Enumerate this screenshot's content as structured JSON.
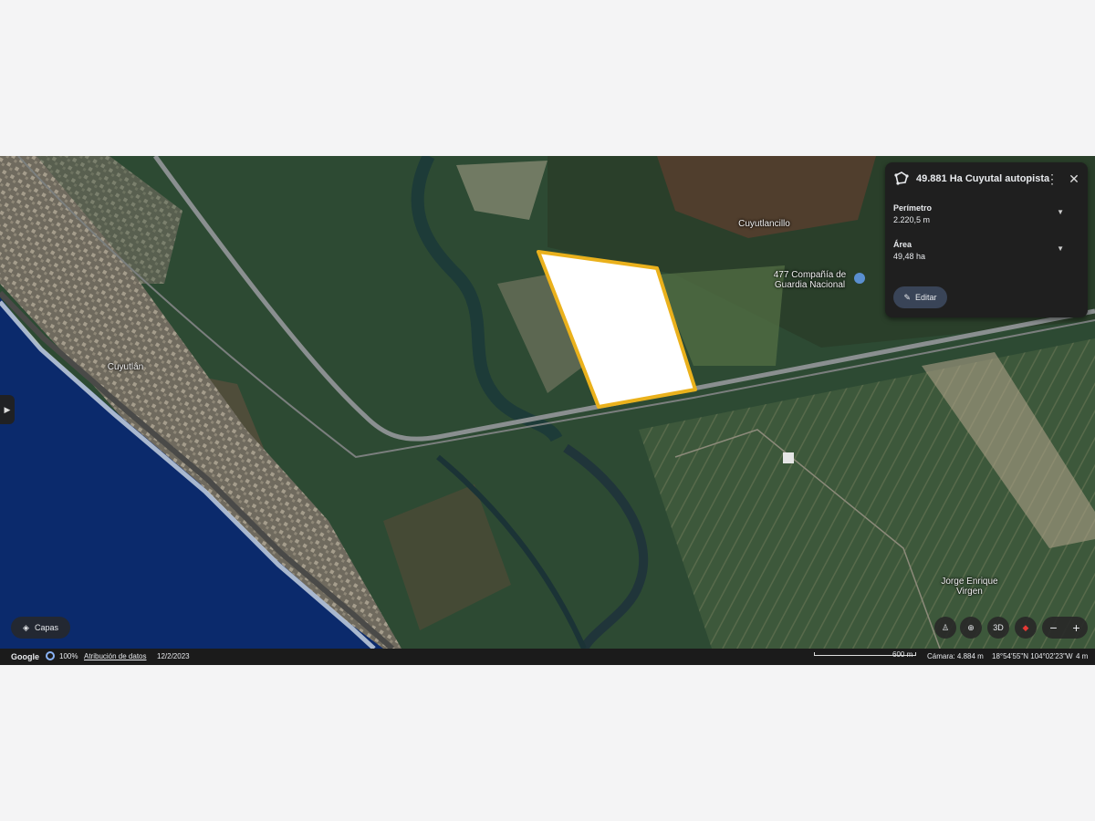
{
  "map": {
    "place_labels": [
      {
        "text": "Cuyutlancillo"
      },
      {
        "text": "477 Compañía de"
      },
      {
        "text": "Guardia Nacional"
      },
      {
        "text": "Cuyutlán"
      },
      {
        "text": "Jorge Enrique"
      },
      {
        "text": "Virgen"
      }
    ],
    "colors": {
      "polygon_fill": "#ffffff",
      "polygon_stroke": "#eab11c",
      "ocean": "#0b2a6c"
    }
  },
  "panel": {
    "title": "49.881 Ha Cuyutal autopista",
    "perimeter_label": "Perímetro",
    "perimeter_value": "2.220,5 m",
    "area_label": "Área",
    "area_value": "49,48 ha",
    "edit_label": "Editar"
  },
  "controls": {
    "layers_label": "Capas",
    "mode_3d": "3D",
    "zoom_out": "−",
    "zoom_in": "+"
  },
  "status": {
    "brand": "Google",
    "zoom_percent": "100%",
    "attribution": "Atribución de datos",
    "imagery_date": "12/2/2023",
    "scale": "600 m",
    "camera": "Cámara: 4.884 m",
    "coordinates": "18°54'55\"N 104°02'23\"W",
    "elevation": "4 m"
  }
}
